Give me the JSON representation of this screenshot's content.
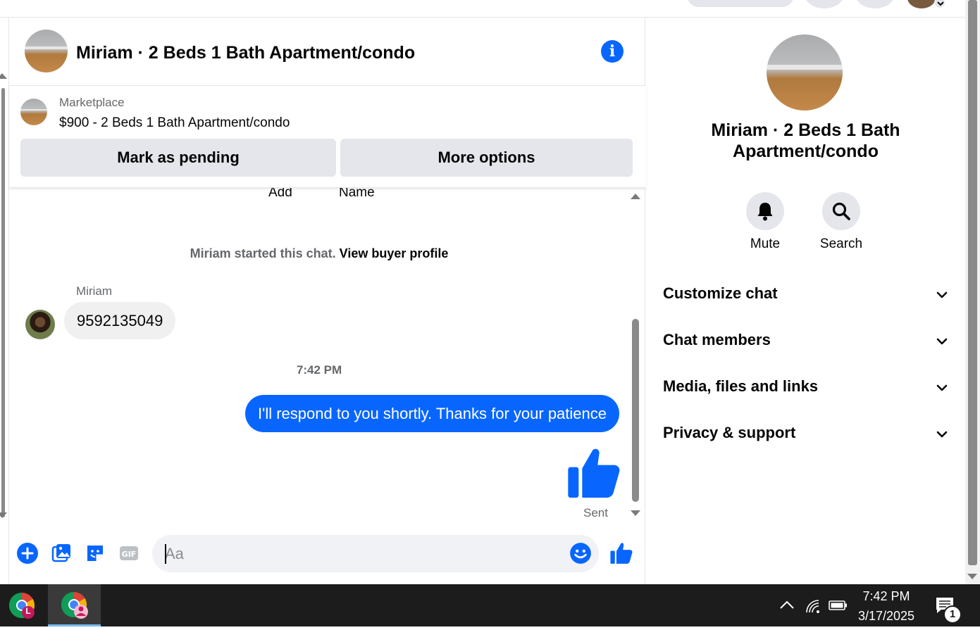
{
  "chat": {
    "title": "Miriam · 2 Beds 1 Bath Apartment/condo",
    "marketplace_label": "Marketplace",
    "listing": "$900 - 2 Beds 1 Bath Apartment/condo",
    "mark_pending": "Mark as pending",
    "more_options": "More options",
    "clipped_add": "Add",
    "clipped_name": "Name",
    "started_text": "Miriam started this chat.",
    "view_buyer": "View buyer profile",
    "sender": "Miriam",
    "incoming_message": "9592135049",
    "timestamp": "7:42 PM",
    "outgoing_message": "I'll respond to you shortly. Thanks for your patience",
    "status": "Sent",
    "input_placeholder": "Aa"
  },
  "panel": {
    "title": "Miriam · 2 Beds 1 Bath Apartment/condo",
    "mute": "Mute",
    "search": "Search",
    "sections": [
      "Customize chat",
      "Chat members",
      "Media, files and links",
      "Privacy & support"
    ]
  },
  "taskbar": {
    "time": "7:42 PM",
    "date": "3/17/2025",
    "notifications": "1",
    "profile_badge": "L"
  },
  "colors": {
    "accent": "#0866ff",
    "bubble_in": "#f0f0f0",
    "taskbar": "#1c1c1c"
  }
}
